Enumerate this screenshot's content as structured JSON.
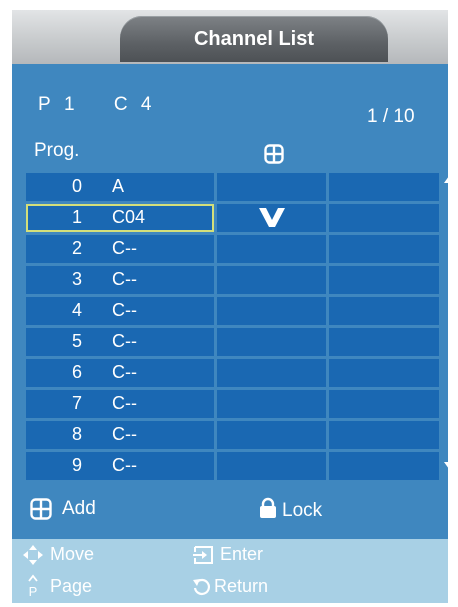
{
  "header": {
    "title": "Channel List"
  },
  "status": {
    "p_label": "P",
    "p_value": "1",
    "c_label": "C",
    "c_value": "4",
    "page_indicator": "1 / 10"
  },
  "columns": {
    "prog_label": "Prog.",
    "add_column_icon": "add-box-icon"
  },
  "rows": [
    {
      "num": "0",
      "name": "A",
      "added": false
    },
    {
      "num": "1",
      "name": "C04",
      "added": true,
      "selected": true
    },
    {
      "num": "2",
      "name": "C--",
      "added": false
    },
    {
      "num": "3",
      "name": "C--",
      "added": false
    },
    {
      "num": "4",
      "name": "C--",
      "added": false
    },
    {
      "num": "5",
      "name": "C--",
      "added": false
    },
    {
      "num": "6",
      "name": "C--",
      "added": false
    },
    {
      "num": "7",
      "name": "C--",
      "added": false
    },
    {
      "num": "8",
      "name": "C--",
      "added": false
    },
    {
      "num": "9",
      "name": "C--",
      "added": false
    }
  ],
  "legend": {
    "add_label": "Add",
    "lock_label": "Lock"
  },
  "footer": {
    "move_label": "Move",
    "enter_label": "Enter",
    "page_label": "Page",
    "return_label": "Return"
  },
  "colors": {
    "panel": "#3f87bf",
    "cell": "#1a68b2",
    "selection_outline": "#d3df7a",
    "footer": "#a8d0e5"
  }
}
